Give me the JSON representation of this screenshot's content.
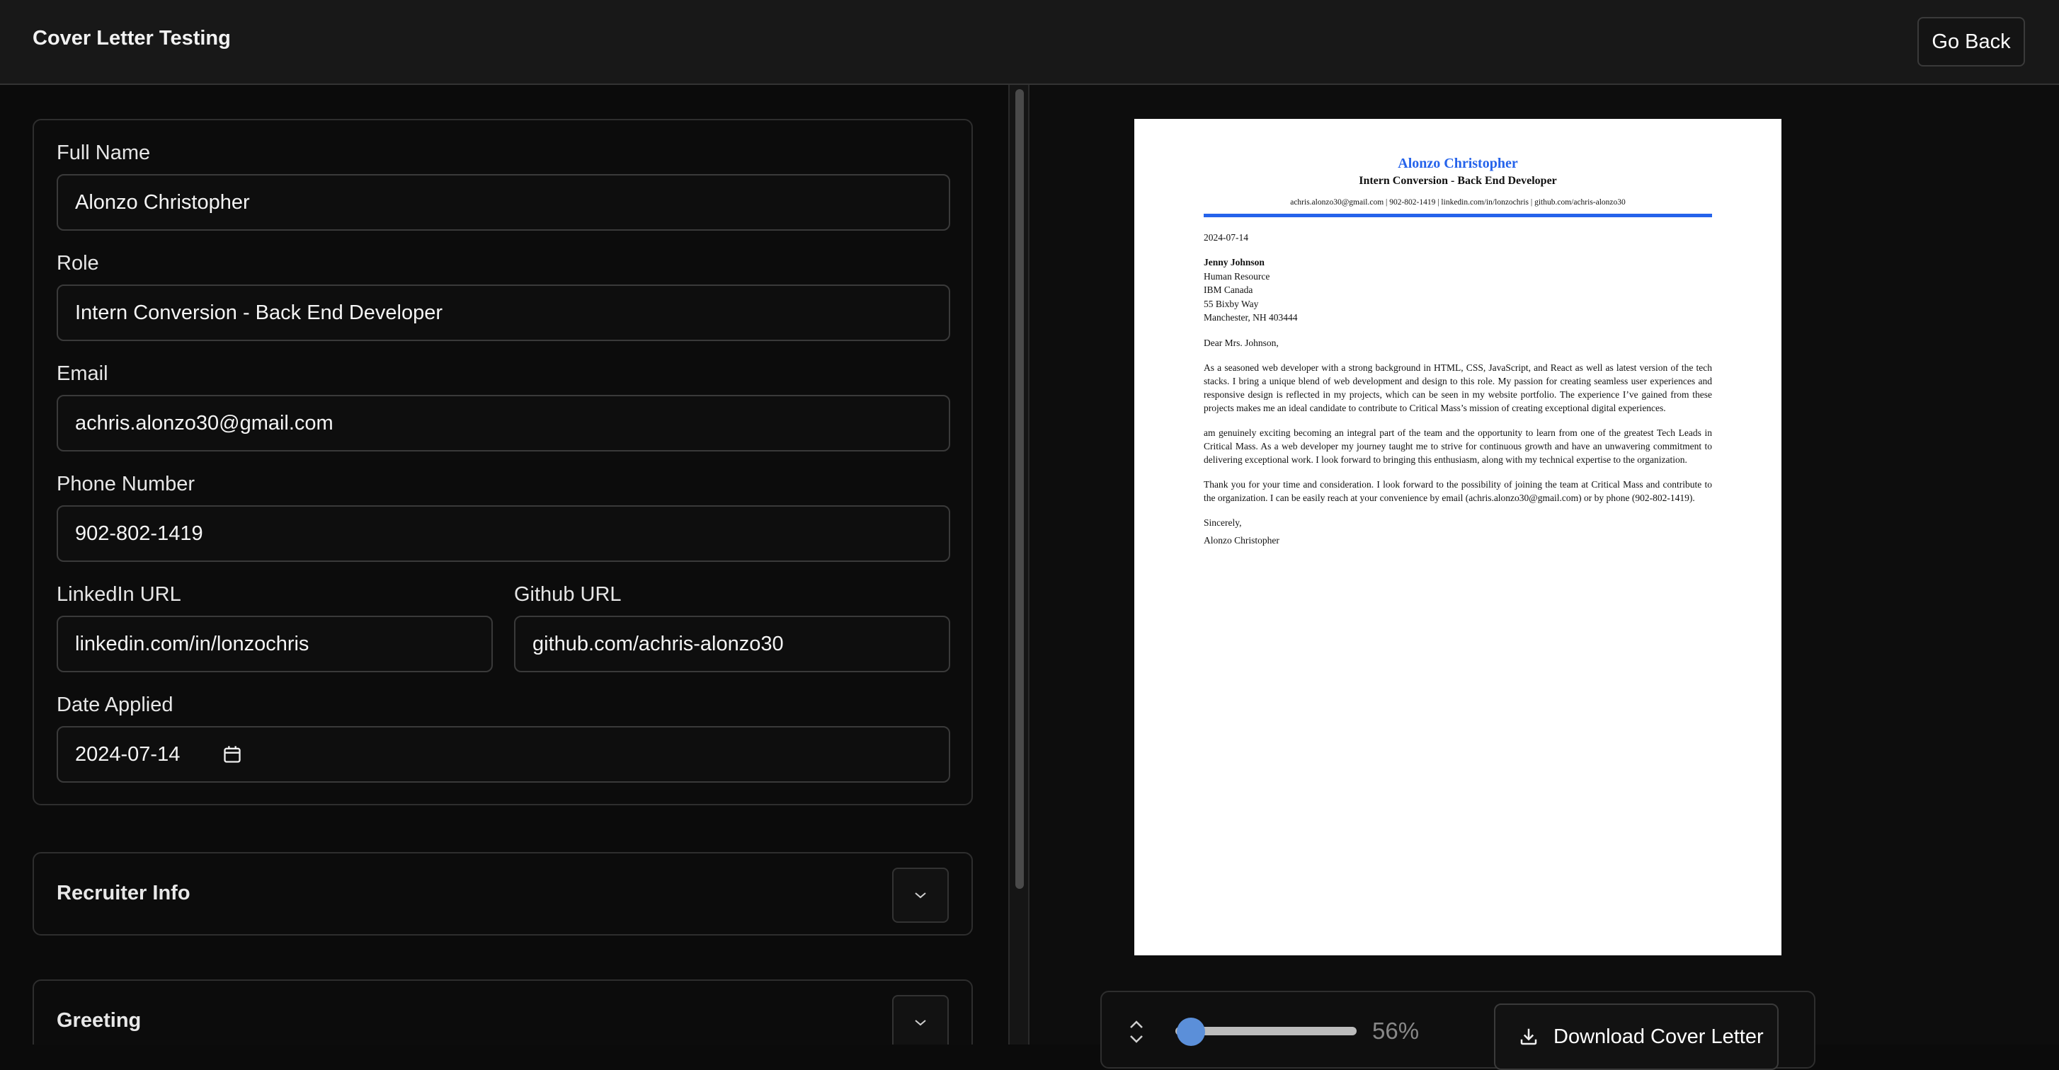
{
  "header": {
    "title": "Cover Letter Testing",
    "back_label": "Go Back"
  },
  "form": {
    "full_name": {
      "label": "Full Name",
      "value": "Alonzo Christopher"
    },
    "role": {
      "label": "Role",
      "value": "Intern Conversion - Back End Developer"
    },
    "email": {
      "label": "Email",
      "value": "achris.alonzo30@gmail.com"
    },
    "phone": {
      "label": "Phone Number",
      "value": "902-802-1419"
    },
    "linkedin": {
      "label": "LinkedIn URL",
      "value": "linkedin.com/in/lonzochris"
    },
    "github": {
      "label": "Github URL",
      "value": "github.com/achris-alonzo30"
    },
    "date": {
      "label": "Date Applied",
      "value": "2024-07-14"
    }
  },
  "sections": [
    {
      "title": "Recruiter Info"
    },
    {
      "title": "Greeting"
    }
  ],
  "preview": {
    "name": "Alonzo Christopher",
    "role": "Intern Conversion - Back End Developer",
    "contact": "achris.alonzo30@gmail.com | 902-802-1419 | linkedin.com/in/lonzochris | github.com/achris-alonzo30",
    "date": "2024-07-14",
    "recipient": {
      "name": "Jenny Johnson",
      "dept": "Human Resource",
      "company": "IBM Canada",
      "street": "55 Bixby Way",
      "city": "Manchester, NH 403444"
    },
    "greeting": "Dear Mrs. Johnson,",
    "para1": "As a seasoned web developer with a strong background in HTML, CSS, JavaScript, and React as well as latest version of the tech stacks. I bring a unique blend of web development and design to this role. My passion for creating seamless user experiences and responsive design is reflected in my projects, which can be seen in my website portfolio. The experience I’ve gained from these projects makes me an ideal candidate to contribute to Critical Mass’s mission of creating exceptional digital experiences.",
    "para2": "am genuinely exciting becoming an integral part of the team and the opportunity to learn from one of the greatest Tech Leads in Critical Mass. As a web developer my journey taught me to strive for continuous growth and have an unwavering commitment to delivering exceptional work. I look forward to bringing this enthusiasm, along with my technical expertise to the organization.",
    "para3": "Thank you for your time and consideration. I look forward to the possibility of joining the team at Critical Mass and contribute to the organization. I can be easily reach at your convenience by email (achris.alonzo30@gmail.com) or by phone (902-802-1419).",
    "closing": "Sincerely,",
    "signature": "Alonzo Christopher"
  },
  "toolbar": {
    "zoom_text": "56%",
    "zoom_value": 0.56,
    "download_label": "Download Cover Letter"
  },
  "colors": {
    "accent": "#2563eb",
    "background": "#0b0b0b",
    "slider_thumb": "#5b8fd9"
  }
}
